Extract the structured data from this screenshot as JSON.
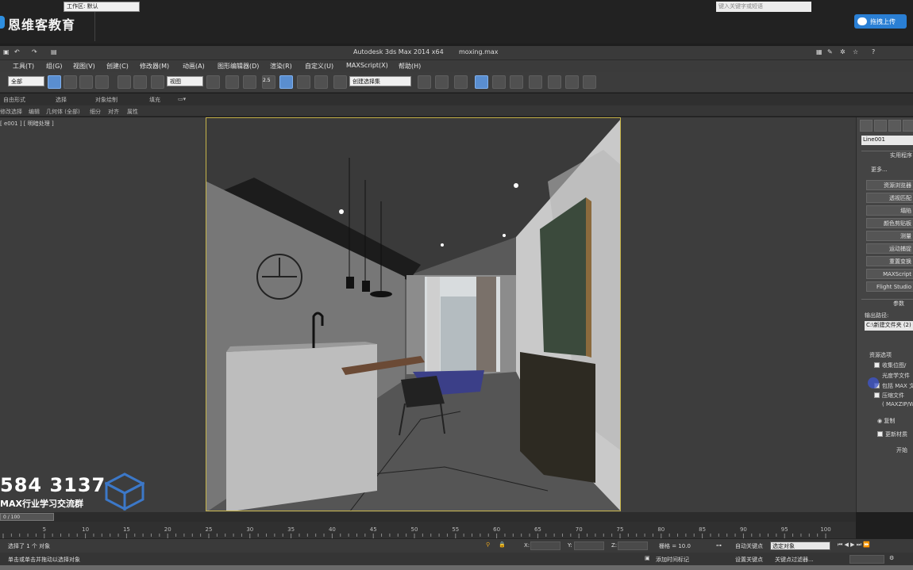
{
  "banner": {
    "logo": "恩维客教育",
    "upload_button": "拖拽上传"
  },
  "app": {
    "title": "Autodesk 3ds Max  2014 x64",
    "file": "moxing.max",
    "workspace": "工作区: 默认",
    "search_placeholder": "键入关键字或短语"
  },
  "menu": [
    "工具(T)",
    "组(G)",
    "视图(V)",
    "创建(C)",
    "修改器(M)",
    "动画(A)",
    "图形编辑器(D)",
    "渲染(R)",
    "自定义(U)",
    "MAXScript(X)",
    "帮助(H)"
  ],
  "toolbar": {
    "filter": "全部",
    "ref_coord": "视图",
    "snap_label": "2.5",
    "named_selection": "创建选择集"
  },
  "ribbon": [
    "自由形式",
    "选择",
    "对象绘制",
    "填充"
  ],
  "subbar": [
    "修改选择",
    "编辑",
    "几何体 (全部)",
    "细分",
    "对齐",
    "属性"
  ],
  "viewport": {
    "label": "[ e001 ] [ 明暗处理 ]"
  },
  "command_panel": {
    "object_name": "Line001",
    "utilities_header": "实用程序",
    "more_button": "更多...",
    "utilities": [
      "资源浏览器",
      "透视匹配",
      "塌陷",
      "颜色剪贴板",
      "测量",
      "运动捕捉",
      "重置变换",
      "MAXScript",
      "Flight Studio"
    ],
    "params_header": "参数",
    "output_path_label": "输出路径:",
    "output_path_value": "C:\\新建文件夹 (2)",
    "resource_options": "资源选项",
    "opt_collect_bitmaps": "收集位图/",
    "opt_photometric": "光度学文件",
    "opt_include_max": "包括 MAX 文",
    "opt_compress": "压缩文件",
    "opt_compress_hint": "( MAXZIP/W",
    "radio_copy": "复制",
    "opt_update_material": "更新材质",
    "start_button": "开始"
  },
  "watermark": {
    "number": "584 3137",
    "text": "MAX行业学习交流群"
  },
  "timeline": {
    "frame_readout": "0 / 100",
    "ticks": [
      "5",
      "10",
      "15",
      "20",
      "25",
      "30",
      "35",
      "40",
      "45",
      "50",
      "55",
      "60",
      "65",
      "70",
      "75",
      "80",
      "85",
      "90",
      "95",
      "100"
    ]
  },
  "status": {
    "selected": "选择了 1 个 对象",
    "hint": "单击或单击并拖动以选择对象",
    "x_label": "X:",
    "y_label": "Y:",
    "z_label": "Z:",
    "grid": "栅格 = 10.0",
    "auto_key": "自动关键点",
    "selected_object": "选定对象",
    "set_key": "设置关键点",
    "key_filter": "关键点过滤器...",
    "add_time_tag": "添加时间标记"
  }
}
